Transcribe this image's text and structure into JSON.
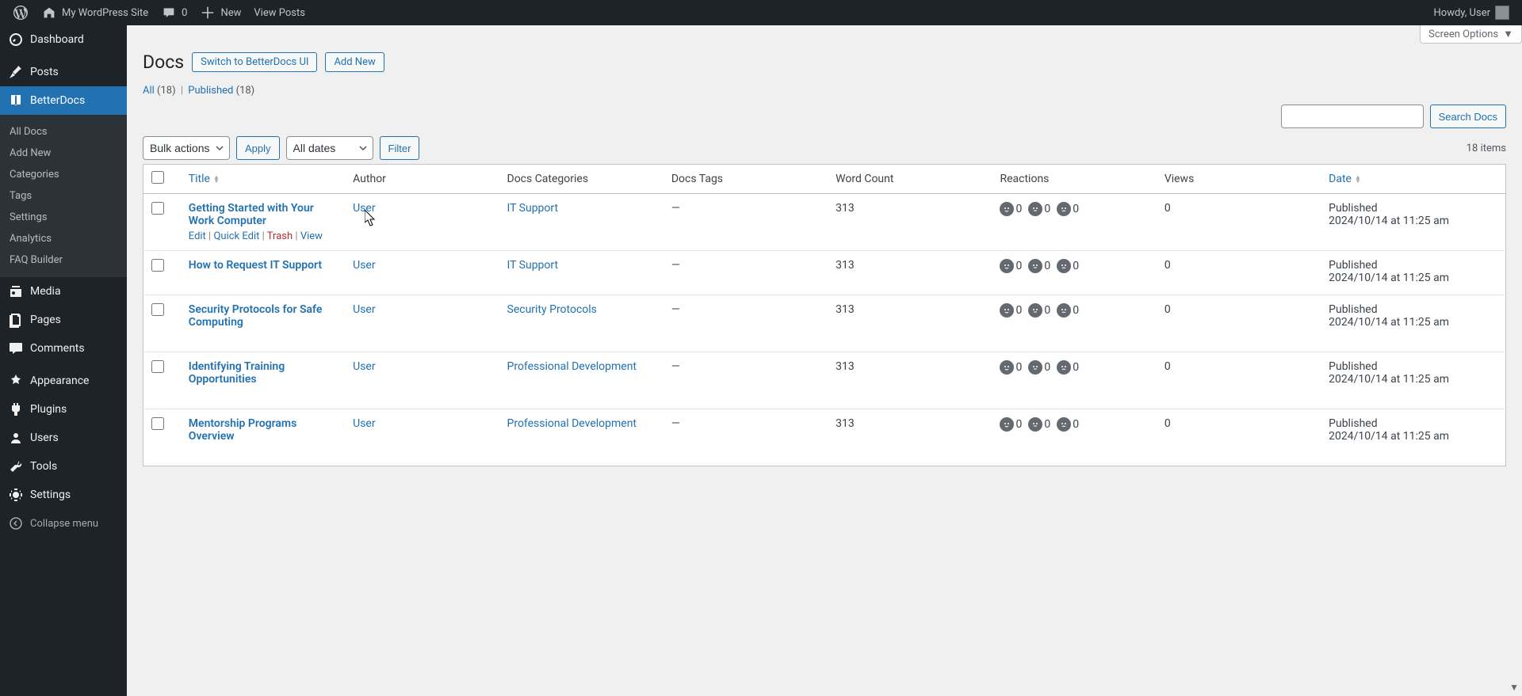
{
  "adminBar": {
    "siteName": "My WordPress Site",
    "commentCount": "0",
    "newLabel": "New",
    "viewPostsLabel": "View Posts",
    "howdy": "Howdy, User"
  },
  "sidebar": {
    "dashboard": "Dashboard",
    "posts": "Posts",
    "betterdocs": "BetterDocs",
    "submenu": {
      "allDocs": "All Docs",
      "addNew": "Add New",
      "categories": "Categories",
      "tags": "Tags",
      "settings": "Settings",
      "analytics": "Analytics",
      "faqBuilder": "FAQ Builder"
    },
    "media": "Media",
    "pages": "Pages",
    "comments": "Comments",
    "appearance": "Appearance",
    "plugins": "Plugins",
    "users": "Users",
    "tools": "Tools",
    "settings": "Settings",
    "collapse": "Collapse menu"
  },
  "page": {
    "title": "Docs",
    "switchUi": "Switch to BetterDocs UI",
    "addNew": "Add New",
    "screenOptions": "Screen Options"
  },
  "filters": {
    "all": "All",
    "allCount": "(18)",
    "published": "Published",
    "publishedCount": "(18)",
    "bulkActions": "Bulk actions",
    "apply": "Apply",
    "allDates": "All dates",
    "filter": "Filter",
    "searchDocs": "Search Docs",
    "itemCount": "18 items"
  },
  "table": {
    "headers": {
      "title": "Title",
      "author": "Author",
      "categories": "Docs Categories",
      "tags": "Docs Tags",
      "wordCount": "Word Count",
      "reactions": "Reactions",
      "views": "Views",
      "date": "Date"
    },
    "rowActions": {
      "edit": "Edit",
      "quickEdit": "Quick Edit",
      "trash": "Trash",
      "view": "View"
    },
    "rows": [
      {
        "title": "Getting Started with Your Work Computer",
        "author": "User",
        "categories": "IT Support",
        "tags": "—",
        "wordCount": "313",
        "reactions": [
          "0",
          "0",
          "0"
        ],
        "views": "0",
        "status": "Published",
        "dateTime": "2024/10/14 at 11:25 am",
        "showActions": true
      },
      {
        "title": "How to Request IT Support",
        "author": "User",
        "categories": "IT Support",
        "tags": "—",
        "wordCount": "313",
        "reactions": [
          "0",
          "0",
          "0"
        ],
        "views": "0",
        "status": "Published",
        "dateTime": "2024/10/14 at 11:25 am",
        "showActions": false
      },
      {
        "title": "Security Protocols for Safe Computing",
        "author": "User",
        "categories": "Security Protocols",
        "tags": "—",
        "wordCount": "313",
        "reactions": [
          "0",
          "0",
          "0"
        ],
        "views": "0",
        "status": "Published",
        "dateTime": "2024/10/14 at 11:25 am",
        "showActions": false
      },
      {
        "title": "Identifying Training Opportunities",
        "author": "User",
        "categories": "Professional Development",
        "tags": "—",
        "wordCount": "313",
        "reactions": [
          "0",
          "0",
          "0"
        ],
        "views": "0",
        "status": "Published",
        "dateTime": "2024/10/14 at 11:25 am",
        "showActions": false
      },
      {
        "title": "Mentorship Programs Overview",
        "author": "User",
        "categories": "Professional Development",
        "tags": "—",
        "wordCount": "313",
        "reactions": [
          "0",
          "0",
          "0"
        ],
        "views": "0",
        "status": "Published",
        "dateTime": "2024/10/14 at 11:25 am",
        "showActions": false
      }
    ]
  }
}
